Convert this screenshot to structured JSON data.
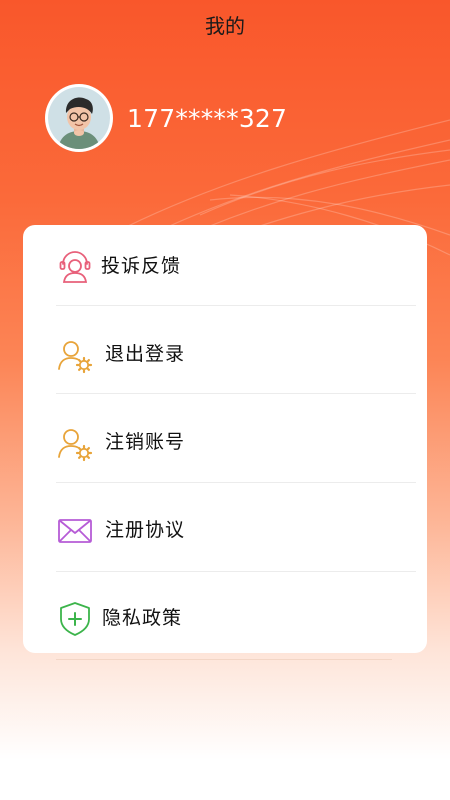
{
  "header": {
    "title": "我的"
  },
  "profile": {
    "phone": "177*****327"
  },
  "menu": {
    "items": [
      {
        "label": "投诉反馈",
        "icon": "headset-user-icon"
      },
      {
        "label": "退出登录",
        "icon": "user-gear-icon"
      },
      {
        "label": "注销账号",
        "icon": "user-gear-icon"
      },
      {
        "label": "注册协议",
        "icon": "envelope-icon"
      },
      {
        "label": "隐私政策",
        "icon": "shield-plus-icon"
      }
    ]
  },
  "colors": {
    "accent": "#f9572b",
    "feedback_icon": "#e8607a",
    "user_gear_icon": "#e8a43a",
    "envelope_icon": "#b65cd6",
    "shield_icon": "#3cb44b"
  }
}
